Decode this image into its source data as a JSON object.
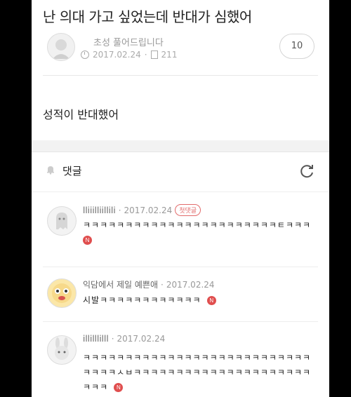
{
  "post": {
    "title": "난 의대 가고 싶었는데 반대가 심했어",
    "author": "초성 풀어드립니다",
    "date": "2017.02.24",
    "views": "211",
    "comment_count": "10",
    "body": "성적이 반대했어"
  },
  "comments_section": {
    "label": "댓글"
  },
  "comments": [
    {
      "name": "lliiilliillili",
      "date": "2017.02.24",
      "badge": "첫댓글",
      "text": "ㅋㅋㅋㅋㅋㅋㅋㅋㅋㅋㅋㅋㅋㅋㅋㅋㅋㅋㅋㅋㅋㅋㅋㅌㅋㅋㅋ",
      "new": "N"
    },
    {
      "name": "익담에서 제일 예쁜애",
      "date": "2017.02.24",
      "text": "시발ㅋㅋㅋㅋㅋㅋㅋㅋㅋㅋㅋㅋ",
      "new": "N"
    },
    {
      "name": "illilllilll",
      "date": "2017.02.24",
      "text": "ㅋㅋㅋㅋㅋㅋㅋㅋㅋㅋㅋㅋㅋㅋㅋㅋㅋㅋㅋㅋㅋㅋㅋㅋㅋㅋㅋㅋㅋㅋㅋㅅㅂㅋㅋㅋㅋㅋㅋㅋㅋㅋㅋㅋㅋㅋㅋㅋㅋㅋㅋㅋㅋㅋㅋㅋㅋ",
      "new": "N"
    }
  ]
}
